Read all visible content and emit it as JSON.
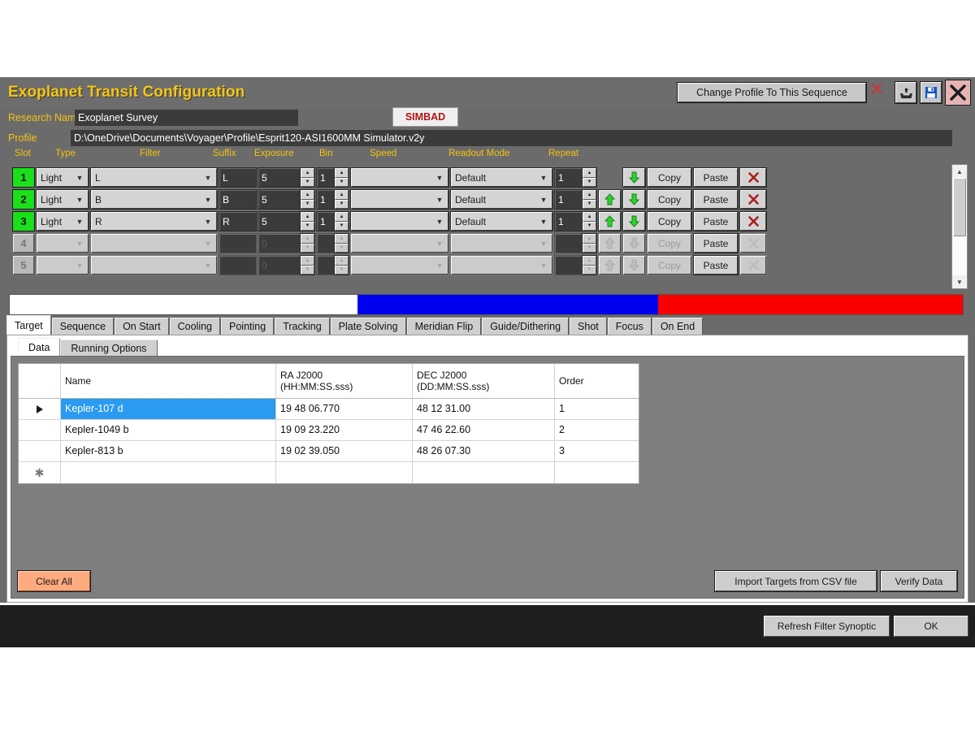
{
  "window": {
    "title": "Exoplanet Transit Configuration",
    "change_profile_button": "Change Profile To This Sequence",
    "discard_icon": "red-x-icon",
    "load_icon": "open-folder-icon",
    "save_icon": "floppy-save-icon",
    "close_icon": "close-x-icon"
  },
  "fields": {
    "research_label": "Research Name",
    "research_value": "Exoplanet Survey",
    "simbad_button": "SIMBAD",
    "profile_label": "Profile",
    "profile_value": "D:\\OneDrive\\Documents\\Voyager\\Profile\\Esprit120-ASI1600MM Simulator.v2y"
  },
  "sequence": {
    "columns": [
      "Slot",
      "Type",
      "Filter",
      "Suffix",
      "Exposure",
      "Bin",
      "Speed",
      "Readout Mode",
      "Repeat"
    ],
    "copy_label": "Copy",
    "paste_label": "Paste",
    "up_icon": "arrow-up-icon",
    "down_icon": "arrow-down-icon",
    "delete_icon": "red-x-icon",
    "rows": [
      {
        "slot": "1",
        "enabled": true,
        "type": "Light",
        "filter": "L",
        "suffix": "L",
        "exposure": "5",
        "bin": "1",
        "speed": "",
        "readout": "Default",
        "repeat": "1",
        "can_move_up": false,
        "can_move_down": true
      },
      {
        "slot": "2",
        "enabled": true,
        "type": "Light",
        "filter": "B",
        "suffix": "B",
        "exposure": "5",
        "bin": "1",
        "speed": "",
        "readout": "Default",
        "repeat": "1",
        "can_move_up": true,
        "can_move_down": true
      },
      {
        "slot": "3",
        "enabled": true,
        "type": "Light",
        "filter": "R",
        "suffix": "R",
        "exposure": "5",
        "bin": "1",
        "speed": "",
        "readout": "Default",
        "repeat": "1",
        "can_move_up": true,
        "can_move_down": true
      },
      {
        "slot": "4",
        "enabled": false,
        "type": "",
        "filter": "",
        "suffix": "",
        "exposure": "0",
        "bin": "",
        "speed": "",
        "readout": "",
        "repeat": "",
        "can_move_up": false,
        "can_move_down": false
      },
      {
        "slot": "5",
        "enabled": false,
        "type": "",
        "filter": "",
        "suffix": "",
        "exposure": "0",
        "bin": "",
        "speed": "",
        "readout": "",
        "repeat": "",
        "can_move_up": false,
        "can_move_down": false
      }
    ]
  },
  "filter_bar": {
    "segments": [
      {
        "label": "white-segment",
        "color": "#ffffff",
        "width_pct": 36.5
      },
      {
        "label": "blue-segment",
        "color": "#0000f0",
        "width_pct": 31.5
      },
      {
        "label": "red-segment",
        "color": "#fa0000",
        "width_pct": 32.0
      }
    ]
  },
  "tabs": {
    "items": [
      "Target",
      "Sequence",
      "On Start",
      "Cooling",
      "Pointing",
      "Tracking",
      "Plate Solving",
      "Meridian Flip",
      "Guide/Dithering",
      "Shot",
      "Focus",
      "On End"
    ],
    "active": "Target"
  },
  "subtabs": {
    "items": [
      "Data",
      "Running Options"
    ],
    "active": "Data"
  },
  "target_grid": {
    "headers": [
      "",
      "Name",
      "RA J2000\n(HH:MM:SS.sss)",
      "DEC J2000\n(DD:MM:SS.sss)",
      "Order"
    ],
    "rows": [
      {
        "marker": "row-selected-arrow",
        "name": "Kepler-107 d",
        "ra": "19 48 06.770",
        "dec": "48 12 31.00",
        "order": "1",
        "selected": true
      },
      {
        "marker": "",
        "name": "Kepler-1049 b",
        "ra": "19 09 23.220",
        "dec": "47 46 22.60",
        "order": "2",
        "selected": false
      },
      {
        "marker": "",
        "name": "Kepler-813 b",
        "ra": "19 02 39.050",
        "dec": "48 26 07.30",
        "order": "3",
        "selected": false
      },
      {
        "marker": "new-row-asterisk",
        "name": "",
        "ra": "",
        "dec": "",
        "order": "",
        "selected": false
      }
    ]
  },
  "panel_buttons": {
    "clear_all": "Clear All",
    "import_csv": "Import Targets from CSV file",
    "verify_data": "Verify Data"
  },
  "footer": {
    "refresh_filter_synoptic": "Refresh Filter Synoptic",
    "ok": "OK"
  },
  "colors": {
    "title_gold": "#f5c518",
    "label_gold": "#f3c211",
    "slot_green": "#1ae01a",
    "selection_blue": "#2a9bf0",
    "clear_all_orange": "#ffab7f",
    "simbad_red": "#b01515"
  }
}
